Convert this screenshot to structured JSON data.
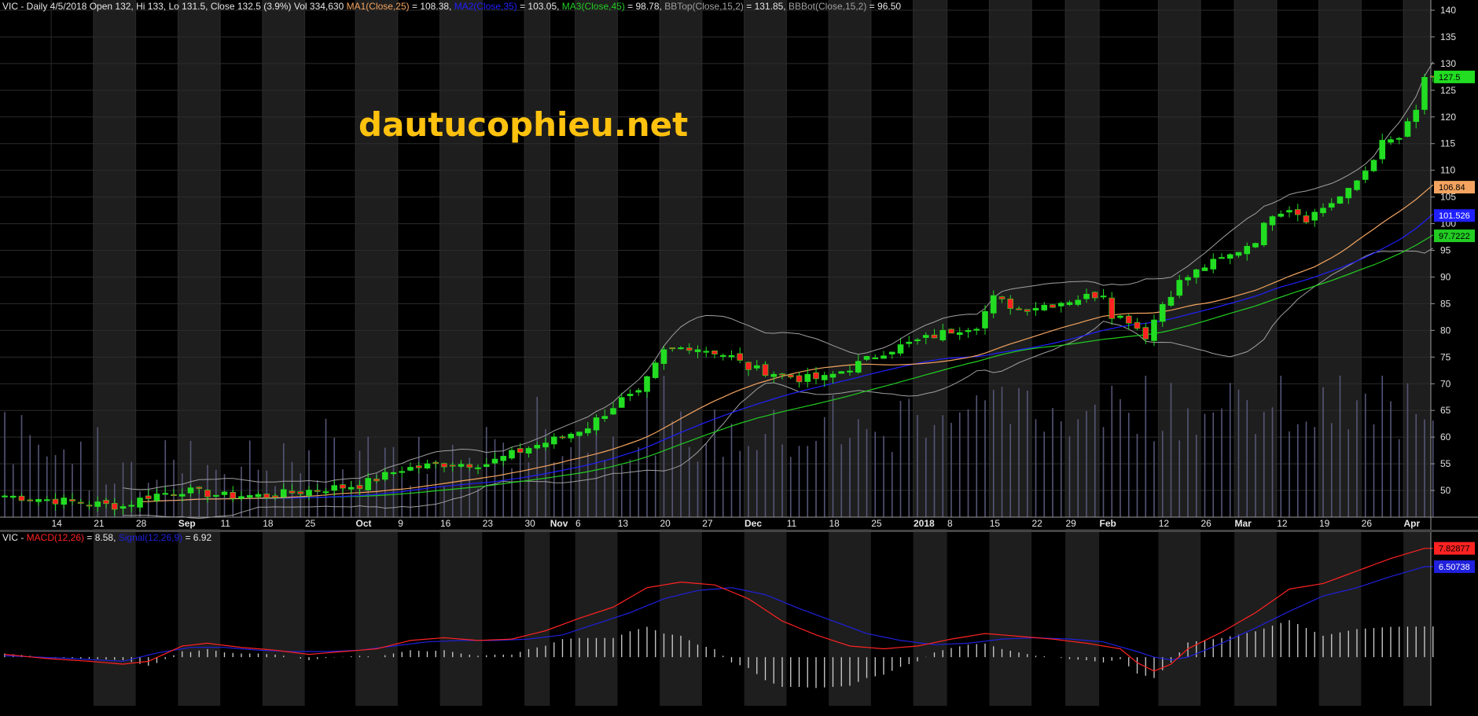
{
  "watermark": "dautucophieu.net",
  "colors": {
    "background": "#000000",
    "band_alt": "#1e1e1e",
    "axis_text": "#e0e0e0",
    "up_candle": "#22dd22",
    "down_candle": "#ff2222",
    "ma1": "#f4a460",
    "ma2": "#2020ff",
    "ma3": "#22cc22",
    "bollinger": "#a0a0a0",
    "volume": "#555577",
    "macd": "#ff2222",
    "signal": "#2020dd",
    "histogram": "#d0d0d0",
    "watermark": "#ffc20e"
  },
  "header": {
    "price": [
      {
        "text": "VIC - Daily 4/5/2018 Open 132, Hi 133, Lo 131.5, Close 132.5 (3.9%) Vol 334,630 ",
        "color": "#e6e6e6"
      },
      {
        "text": "MA1(Close,25)",
        "color": "#f4a460"
      },
      {
        "text": " = 108.38, ",
        "color": "#e6e6e6"
      },
      {
        "text": "MA2(Close,35)",
        "color": "#2020ff"
      },
      {
        "text": " = 103.05, ",
        "color": "#e6e6e6"
      },
      {
        "text": "MA3(Close,45)",
        "color": "#22cc22"
      },
      {
        "text": " = 98.78, ",
        "color": "#e6e6e6"
      },
      {
        "text": "BBTop(Close,15,2)",
        "color": "#a0a0a0"
      },
      {
        "text": " = 131.85, ",
        "color": "#e6e6e6"
      },
      {
        "text": "BBBot(Close,15,2)",
        "color": "#a0a0a0"
      },
      {
        "text": " = 96.50",
        "color": "#e6e6e6"
      }
    ],
    "macd": [
      {
        "text": "VIC - ",
        "color": "#e6e6e6"
      },
      {
        "text": "MACD(12,26)",
        "color": "#ff2222"
      },
      {
        "text": " = 8.58, ",
        "color": "#e6e6e6"
      },
      {
        "text": "Signal(12,26,9)",
        "color": "#2020dd"
      },
      {
        "text": " = 6.92",
        "color": "#e6e6e6"
      }
    ]
  },
  "price_tags": [
    {
      "label": "127.5",
      "value": 127.5,
      "bg": "#22dd22",
      "fg": "#000000"
    },
    {
      "label": "106.84",
      "value": 106.84,
      "bg": "#f4a460",
      "fg": "#000000"
    },
    {
      "label": "101.526",
      "value": 101.526,
      "bg": "#2020ff",
      "fg": "#ffffff"
    },
    {
      "label": "97.7222",
      "value": 97.7222,
      "bg": "#22cc22",
      "fg": "#000000"
    }
  ],
  "macd_tags": [
    {
      "label": "7.82877",
      "value": 7.83,
      "bg": "#ff2222",
      "fg": "#000000"
    },
    {
      "label": "6.50738",
      "value": 6.51,
      "bg": "#2020dd",
      "fg": "#ffffff"
    }
  ],
  "chart_data": [
    {
      "type": "candlestick",
      "title": "VIC - Daily 4/5/2018",
      "ylim": [
        45,
        140
      ],
      "yticks": [
        50,
        55,
        60,
        65,
        70,
        75,
        80,
        85,
        90,
        95,
        100,
        105,
        110,
        115,
        120,
        125,
        130,
        135,
        140
      ],
      "x_labels": [
        {
          "i": 6,
          "label": "14",
          "bold": false
        },
        {
          "i": 11,
          "label": "21",
          "bold": false
        },
        {
          "i": 16,
          "label": "28",
          "bold": false
        },
        {
          "i": 21,
          "label": "Sep",
          "bold": true
        },
        {
          "i": 26,
          "label": "11",
          "bold": false
        },
        {
          "i": 31,
          "label": "18",
          "bold": false
        },
        {
          "i": 36,
          "label": "25",
          "bold": false
        },
        {
          "i": 42,
          "label": "Oct",
          "bold": true
        },
        {
          "i": 47,
          "label": "9",
          "bold": false
        },
        {
          "i": 52,
          "label": "16",
          "bold": false
        },
        {
          "i": 57,
          "label": "23",
          "bold": false
        },
        {
          "i": 62,
          "label": "30",
          "bold": false
        },
        {
          "i": 65,
          "label": "Nov",
          "bold": true
        },
        {
          "i": 68,
          "label": "6",
          "bold": false
        },
        {
          "i": 73,
          "label": "13",
          "bold": false
        },
        {
          "i": 78,
          "label": "20",
          "bold": false
        },
        {
          "i": 83,
          "label": "27",
          "bold": false
        },
        {
          "i": 88,
          "label": "Dec",
          "bold": true
        },
        {
          "i": 93,
          "label": "11",
          "bold": false
        },
        {
          "i": 98,
          "label": "18",
          "bold": false
        },
        {
          "i": 103,
          "label": "25",
          "bold": false
        },
        {
          "i": 108,
          "label": "2018",
          "bold": true
        },
        {
          "i": 112,
          "label": "8",
          "bold": false
        },
        {
          "i": 117,
          "label": "15",
          "bold": false
        },
        {
          "i": 122,
          "label": "22",
          "bold": false
        },
        {
          "i": 126,
          "label": "29",
          "bold": false
        },
        {
          "i": 130,
          "label": "Feb",
          "bold": true
        },
        {
          "i": 137,
          "label": "12",
          "bold": false
        },
        {
          "i": 142,
          "label": "26",
          "bold": false
        },
        {
          "i": 146,
          "label": "Mar",
          "bold": true
        },
        {
          "i": 151,
          "label": "12",
          "bold": false
        },
        {
          "i": 156,
          "label": "19",
          "bold": false
        },
        {
          "i": 161,
          "label": "26",
          "bold": false
        },
        {
          "i": 166,
          "label": "Apr",
          "bold": true
        }
      ],
      "close_anchors": [
        [
          0,
          49
        ],
        [
          14,
          47
        ],
        [
          17,
          49
        ],
        [
          21,
          50
        ],
        [
          26,
          49
        ],
        [
          31,
          49
        ],
        [
          36,
          50
        ],
        [
          42,
          51
        ],
        [
          47,
          54
        ],
        [
          52,
          55
        ],
        [
          57,
          55
        ],
        [
          62,
          58
        ],
        [
          66,
          60
        ],
        [
          69,
          62
        ],
        [
          73,
          67
        ],
        [
          75,
          68
        ],
        [
          78,
          76
        ],
        [
          81,
          77
        ],
        [
          84,
          76
        ],
        [
          86,
          75
        ],
        [
          88,
          73
        ],
        [
          91,
          72
        ],
        [
          94,
          71
        ],
        [
          97,
          71
        ],
        [
          100,
          73
        ],
        [
          104,
          76
        ],
        [
          108,
          78
        ],
        [
          112,
          80
        ],
        [
          115,
          81
        ],
        [
          117,
          86
        ],
        [
          120,
          84
        ],
        [
          124,
          85
        ],
        [
          127,
          86
        ],
        [
          130,
          87
        ],
        [
          131,
          83
        ],
        [
          133,
          82
        ],
        [
          135,
          79
        ],
        [
          137,
          85
        ],
        [
          139,
          89
        ],
        [
          142,
          92
        ],
        [
          145,
          94
        ],
        [
          148,
          97
        ],
        [
          150,
          102
        ],
        [
          152,
          103
        ],
        [
          154,
          101
        ],
        [
          156,
          103
        ],
        [
          159,
          106
        ],
        [
          161,
          110
        ],
        [
          163,
          115
        ],
        [
          165,
          116
        ],
        [
          167,
          121
        ],
        [
          168,
          127.5
        ]
      ],
      "volume_ylim": [
        0,
        10000000
      ]
    },
    {
      "type": "line",
      "title": "VIC - MACD(12,26)",
      "series": [
        {
          "name": "MACD(12,26)",
          "x": [
            0,
            5,
            10,
            14,
            17,
            21,
            24,
            28,
            32,
            36,
            40,
            44,
            48,
            52,
            56,
            60,
            64,
            68,
            72,
            76,
            80,
            84,
            88,
            92,
            96,
            100,
            104,
            108,
            112,
            116,
            120,
            124,
            128,
            132,
            134,
            136,
            138,
            140,
            144,
            148,
            152,
            156,
            160,
            164,
            168
          ],
          "y": [
            0.2,
            -0.1,
            -0.3,
            -0.5,
            -0.3,
            0.8,
            1.0,
            0.7,
            0.5,
            0.2,
            0.4,
            0.6,
            1.2,
            1.4,
            1.2,
            1.3,
            1.9,
            2.8,
            3.6,
            5.0,
            5.4,
            5.2,
            4.2,
            2.6,
            1.6,
            0.8,
            0.6,
            0.8,
            1.3,
            1.7,
            1.5,
            1.3,
            1.0,
            0.6,
            -0.4,
            -1.0,
            -0.5,
            0.6,
            1.8,
            3.2,
            4.9,
            5.3,
            6.2,
            7.1,
            7.83
          ]
        },
        {
          "name": "Signal(12,26,9)",
          "x": [
            0,
            8,
            14,
            18,
            22,
            26,
            30,
            34,
            38,
            42,
            46,
            50,
            54,
            58,
            62,
            66,
            70,
            74,
            78,
            82,
            86,
            90,
            94,
            98,
            102,
            106,
            110,
            114,
            118,
            122,
            126,
            130,
            134,
            136,
            138,
            140,
            144,
            148,
            152,
            156,
            160,
            164,
            168
          ],
          "y": [
            0.1,
            -0.1,
            -0.3,
            0.3,
            0.7,
            0.7,
            0.5,
            0.4,
            0.4,
            0.5,
            0.8,
            1.1,
            1.2,
            1.2,
            1.3,
            1.6,
            2.4,
            3.2,
            4.2,
            4.8,
            5.0,
            4.5,
            3.5,
            2.6,
            1.7,
            1.2,
            0.9,
            1.0,
            1.3,
            1.4,
            1.3,
            1.1,
            0.4,
            0.0,
            -0.2,
            0.0,
            1.0,
            2.1,
            3.3,
            4.4,
            5.0,
            5.8,
            6.51
          ]
        }
      ],
      "ylim": [
        -3.5,
        9
      ]
    }
  ]
}
